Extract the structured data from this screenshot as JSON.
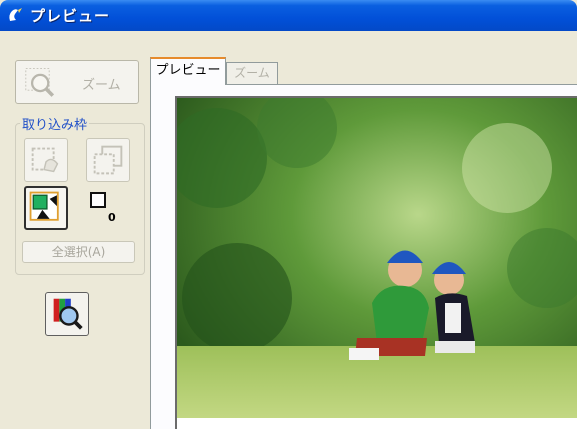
{
  "window": {
    "title": "プレビュー"
  },
  "left_panel": {
    "zoom_button_label": "ズーム",
    "frame_group_label": "取り込み枠",
    "frame_count": "0",
    "select_all_label": "全選択(A)"
  },
  "tabs": [
    {
      "label": "プレビュー",
      "active": true
    },
    {
      "label": "ズーム",
      "active": false
    }
  ],
  "icons": {
    "app": "scanner-app-icon",
    "zoom": "zoom-preview-icon",
    "delete_frame": "delete-frame-icon",
    "copy_frame": "copy-frame-icon",
    "auto_frame": "auto-locate-icon",
    "frame_marker": "frame-marker-icon",
    "image_adjust": "image-adjust-icon"
  },
  "colors": {
    "titlebar": "#0250d8",
    "tab_accent": "#e68b2c",
    "group_label": "#2050c8"
  }
}
